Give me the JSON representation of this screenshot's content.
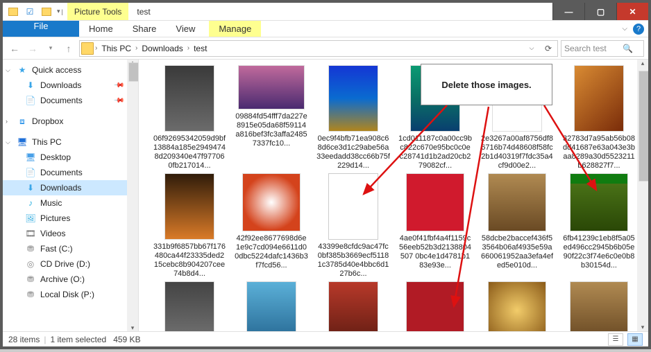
{
  "titlebar": {
    "context_tab": "Picture Tools",
    "caption": "test"
  },
  "ribbon": {
    "file": "File",
    "tabs": [
      "Home",
      "Share",
      "View"
    ],
    "context_tab": "Manage"
  },
  "address": {
    "crumbs": [
      "This PC",
      "Downloads",
      "test"
    ],
    "search_placeholder": "Search test"
  },
  "sidebar": {
    "quick_access": "Quick access",
    "qa_items": [
      {
        "label": "Downloads",
        "pinned": true
      },
      {
        "label": "Documents",
        "pinned": true
      }
    ],
    "dropbox": "Dropbox",
    "this_pc": "This PC",
    "pc_items": [
      "Desktop",
      "Documents",
      "Downloads",
      "Music",
      "Pictures",
      "Videos",
      "Fast (C:)",
      "CD Drive (D:)",
      "Archive (O:)",
      "Local Disk (P:)"
    ]
  },
  "files": [
    {
      "name": "06f92695342059d9bf13884a185e29494748d209340e47f977060fb217014...",
      "thumb": "t01",
      "shape": "tall"
    },
    {
      "name": "09884fd54fff7da227e8915e05da68f59114a816bef3fc3affa24857337fc10...",
      "thumb": "t02",
      "shape": "wide"
    },
    {
      "name": "0ec9f4bfb71ea908c68d6ce3d1c29abe56a33eedadd38cc66b75f229d14...",
      "thumb": "t03",
      "shape": "tall"
    },
    {
      "name": "1cd011187c0a00cc9bc822c670e95bc0c0ec28741d1b2ad20cb279082cf...",
      "thumb": "t04",
      "shape": "tall"
    },
    {
      "name": "2e3267a00af8756df86716b74d48608f58fc2b1d40319f7fdc35a4cf9d00e2...",
      "thumb": "t05",
      "shape": "tall"
    },
    {
      "name": "32783d7a95ab56b08dd41687e63a043e3baa8289a30d5523211b628827f7...",
      "thumb": "t06",
      "shape": "tall"
    },
    {
      "name": "331b9f6857bb67f176480ca44f23335ded215cebc8b904207cee74b8d4...",
      "thumb": "t07",
      "shape": "tall"
    },
    {
      "name": "42f92ee8677698d6e1e9c7cd094e6611d00dbc5224dafc1436b3f7fcd56...",
      "thumb": "t08",
      "shape": "sq"
    },
    {
      "name": "43399e8cfdc9ac47fc0bf385b3669ecf51181c3785d40e4bbc6d127b6c...",
      "thumb": "t09",
      "shape": "tall"
    },
    {
      "name": "4ae0f41fbf4a4f1159c56eeb52b3d2138804507 0bc4e1d4781b183e93e...",
      "thumb": "t10",
      "shape": "sq"
    },
    {
      "name": "58dcbe2baccef436f53564b06af4935e59a660061952aa3efa4efed5e010d...",
      "thumb": "t11",
      "shape": "sq"
    },
    {
      "name": "6fb41239c1eb8f5a05ed496cc2945b6b05e90f22c3f74e6c0e0b8b30154d...",
      "thumb": "t12",
      "shape": "sq"
    },
    {
      "name": "",
      "thumb": "t15",
      "shape": "tall"
    },
    {
      "name": "",
      "thumb": "t16",
      "shape": "tall"
    },
    {
      "name": "",
      "thumb": "t17",
      "shape": "tall"
    },
    {
      "name": "",
      "thumb": "t13",
      "shape": "sq"
    },
    {
      "name": "",
      "thumb": "t14",
      "shape": "sq"
    },
    {
      "name": "",
      "thumb": "t11",
      "shape": "sq"
    }
  ],
  "status": {
    "count": "28 items",
    "selection": "1 item selected",
    "size": "459 KB"
  },
  "annotation": {
    "text": "Delete those images."
  }
}
